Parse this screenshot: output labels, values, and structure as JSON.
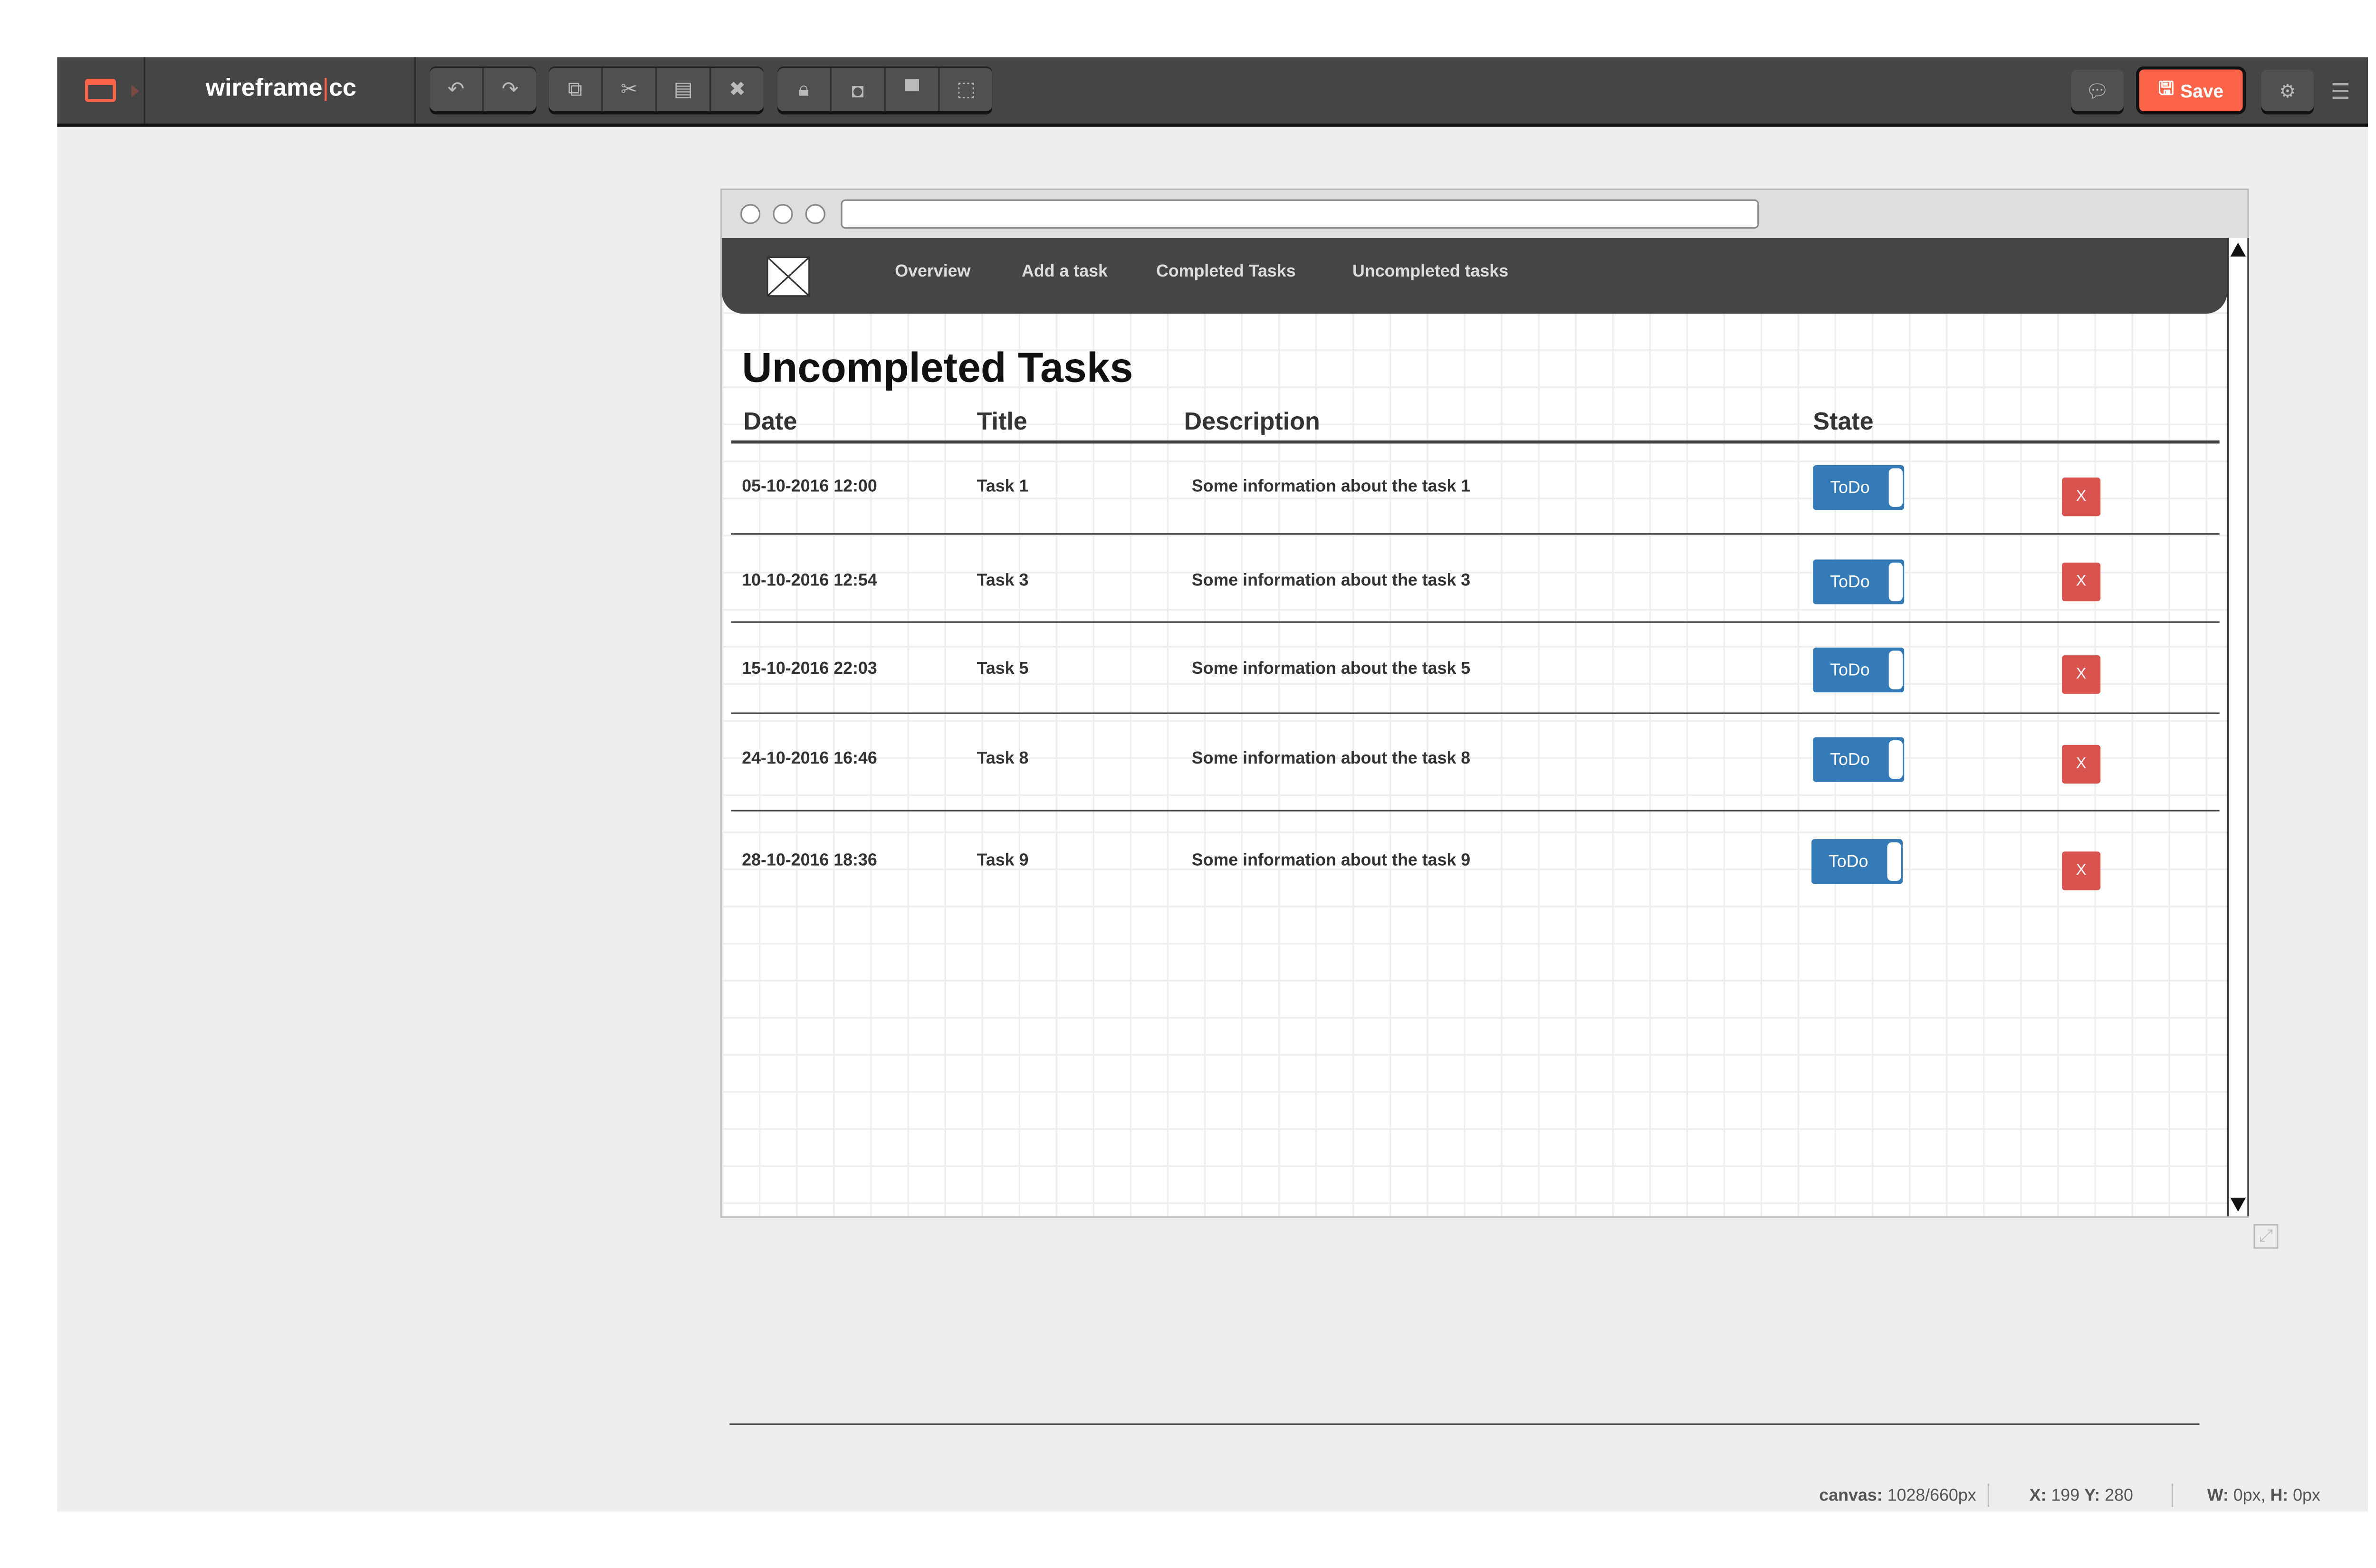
{
  "app": {
    "brand_main": "wireframe",
    "brand_suffix": "cc"
  },
  "toolbar": {
    "groups": [
      [
        "undo-icon",
        "redo-icon"
      ],
      [
        "copy-icon",
        "cut-icon",
        "paste-icon",
        "delete-icon"
      ],
      [
        "lock-icon",
        "bring-front-icon",
        "send-back-icon",
        "group-icon"
      ]
    ],
    "save_label": "Save",
    "accent": "#fc6449"
  },
  "wireframe": {
    "nav": [
      "Overview",
      "Add a task",
      "Completed Tasks",
      "Uncompleted tasks"
    ],
    "heading": "Uncompleted Tasks",
    "columns": [
      "Date",
      "Title",
      "Description",
      "State"
    ],
    "rows": [
      {
        "date": "05-10-2016 12:00",
        "title": "Task 1",
        "desc": "Some information about the task 1",
        "state": "ToDo",
        "del": "X"
      },
      {
        "date": "10-10-2016 12:54",
        "title": "Task 3",
        "desc": "Some information about the task 3",
        "state": "ToDo",
        "del": "X"
      },
      {
        "date": "15-10-2016 22:03",
        "title": "Task 5",
        "desc": "Some information about the task 5",
        "state": "ToDo",
        "del": "X"
      },
      {
        "date": "24-10-2016 16:46",
        "title": "Task 8",
        "desc": "Some information about the task 8",
        "state": "ToDo",
        "del": "X"
      },
      {
        "date": "28-10-2016 18:36",
        "title": "Task 9",
        "desc": "Some information about the task 9",
        "state": "ToDo",
        "del": "X"
      }
    ]
  },
  "status": {
    "canvas_label": "canvas:",
    "canvas_value": "1028/660px",
    "x_label": "X:",
    "x_value": "199",
    "y_label": "Y:",
    "y_value": "280",
    "w_label": "W:",
    "w_value": "0px,",
    "h_label": "H:",
    "h_value": "0px"
  }
}
